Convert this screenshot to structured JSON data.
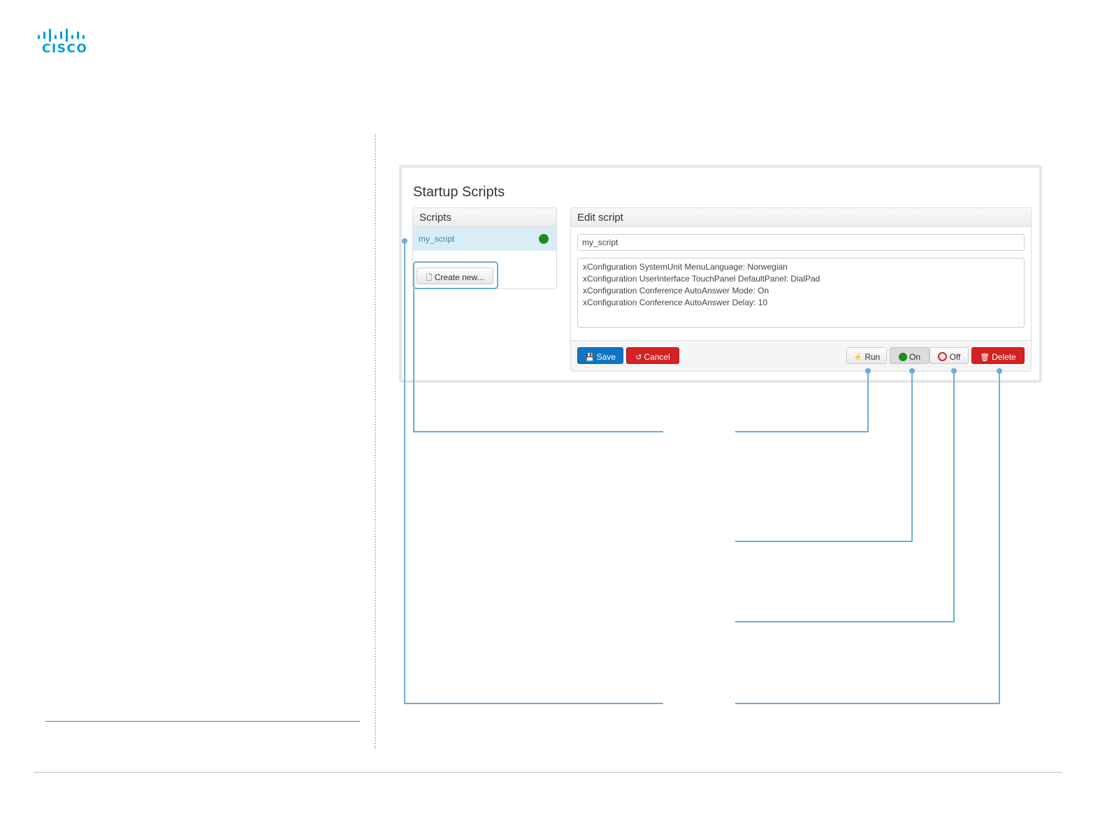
{
  "brand": {
    "logo_text": "CISCO",
    "color": "#049fd9"
  },
  "panel": {
    "title": "Startup Scripts"
  },
  "scripts": {
    "header": "Scripts",
    "items": [
      {
        "name": "my_script",
        "status": "active",
        "status_color": "#1d8b1d"
      }
    ],
    "create_label": "Create new..."
  },
  "editor": {
    "header": "Edit script",
    "name_value": "my_script",
    "lines": [
      "xConfiguration SystemUnit MenuLanguage: Norwegian",
      "xConfiguration UserInterface TouchPanel DefaultPanel: DialPad",
      "xConfiguration Conference AutoAnswer Mode: On",
      "xConfiguration Conference AutoAnswer Delay: 10"
    ]
  },
  "buttons": {
    "save": "Save",
    "cancel": "Cancel",
    "run": "Run",
    "on": "On",
    "off": "Off",
    "delete": "Delete"
  },
  "colors": {
    "callout_line": "#6aaed6",
    "primary": "#0e74c4",
    "danger": "#d42121",
    "active_row": "#d9edf7"
  }
}
